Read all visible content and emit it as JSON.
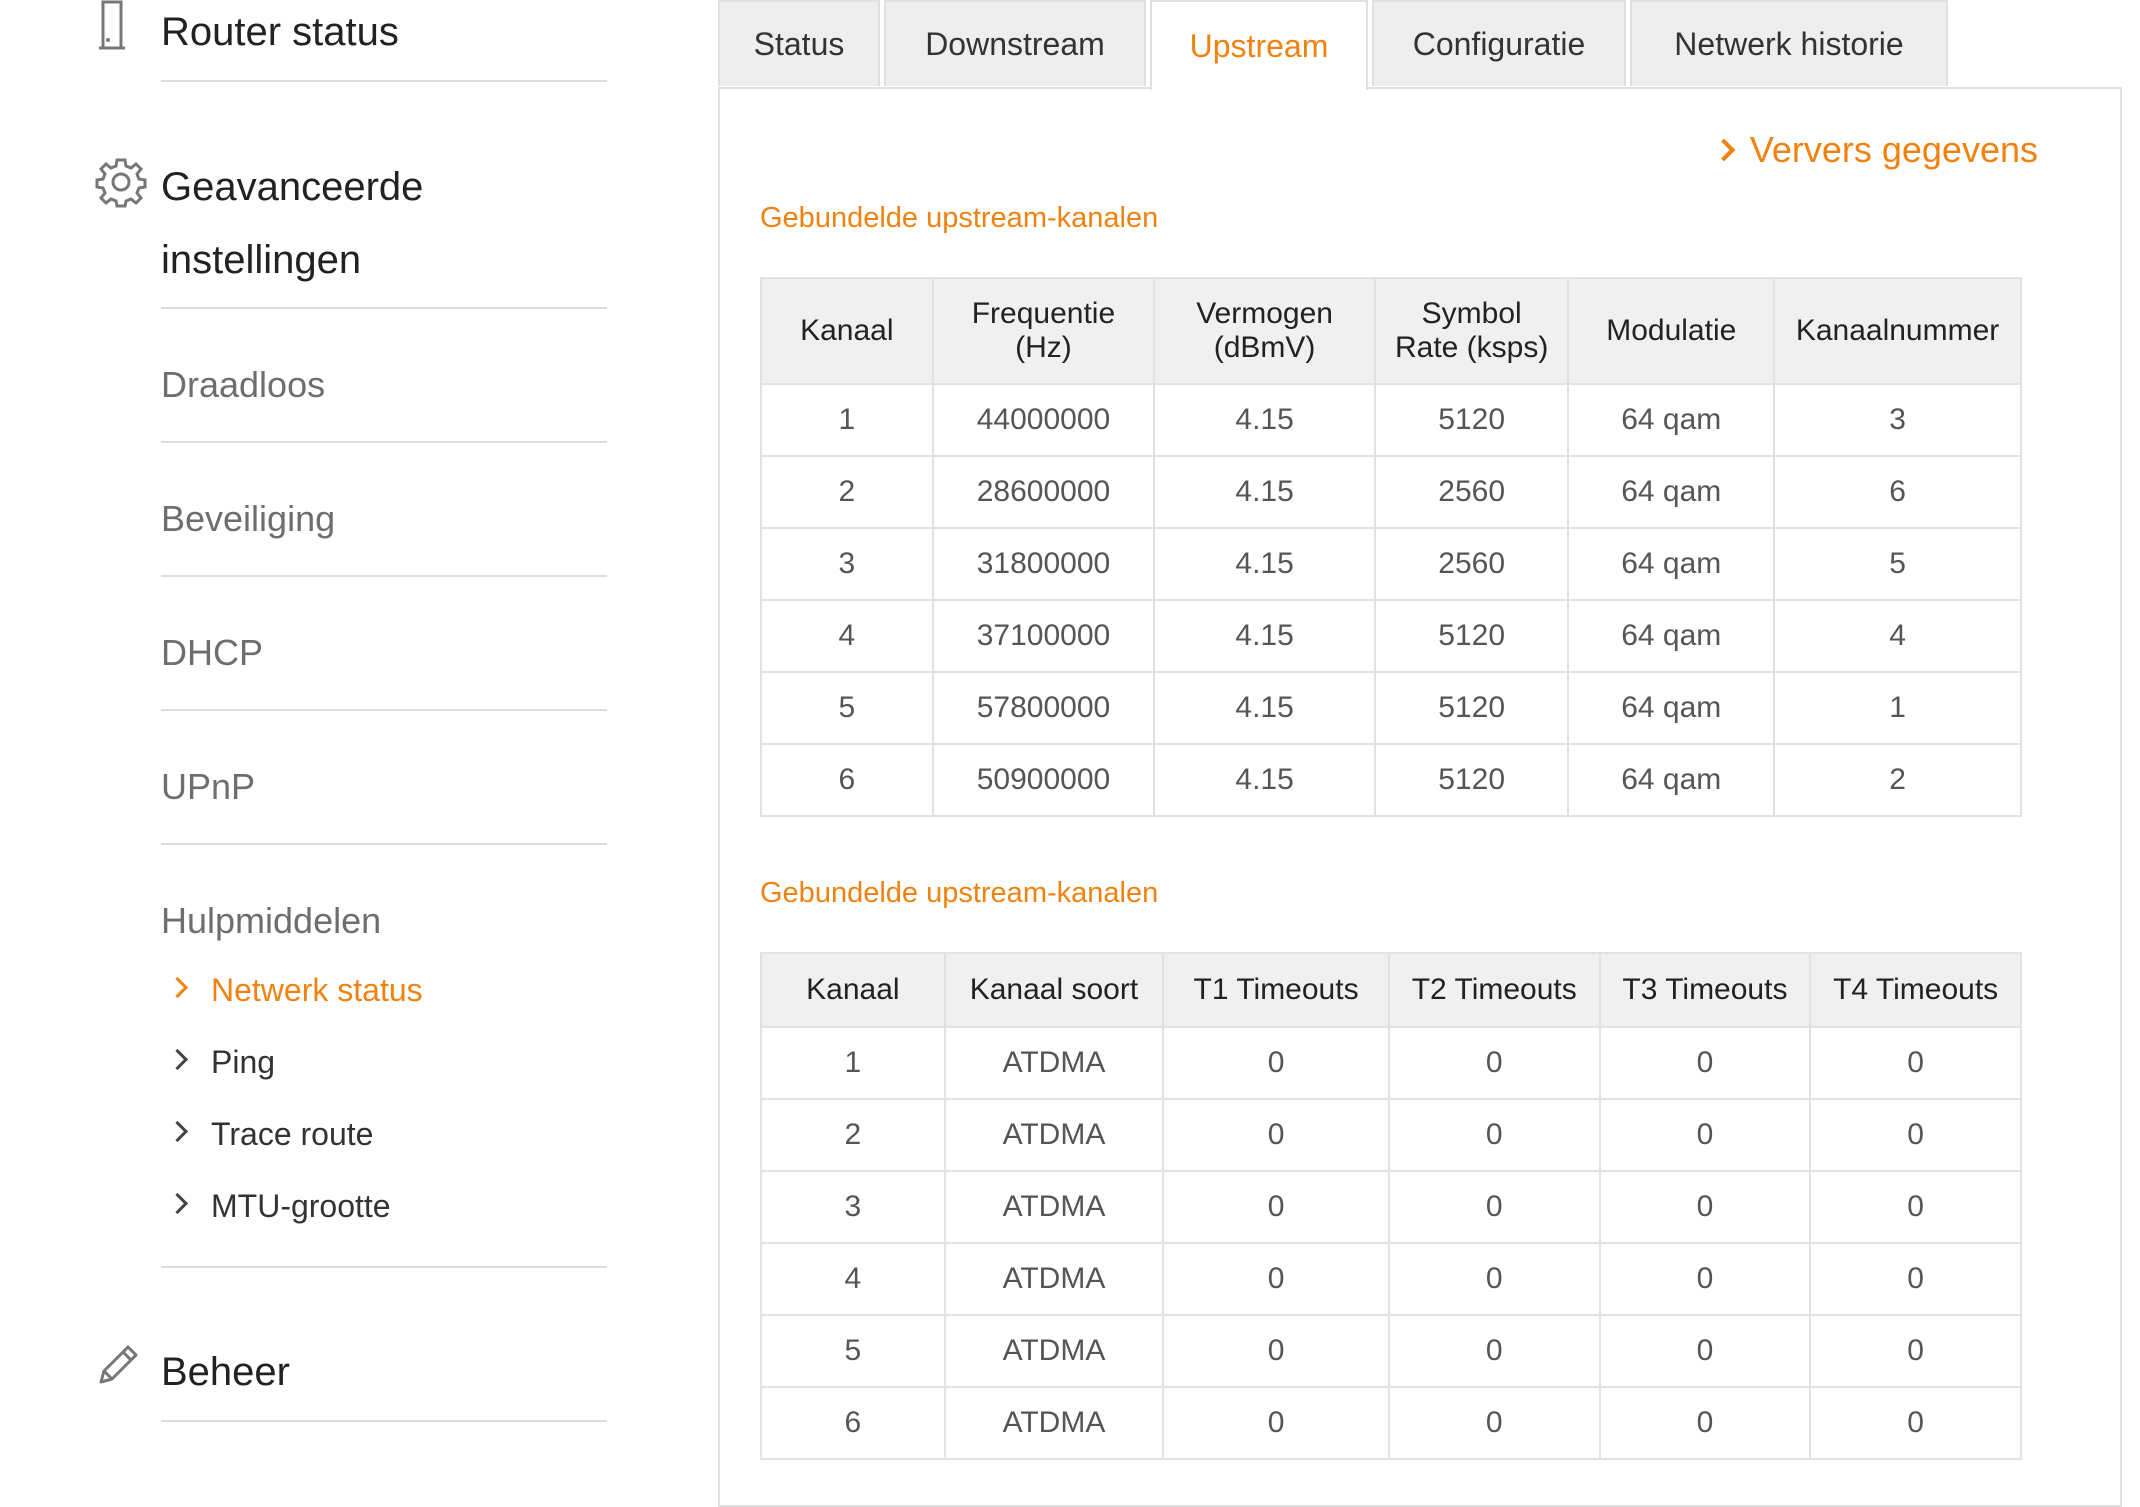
{
  "sidebar": {
    "router_status": "Router status",
    "advanced_line1": "Geavanceerde",
    "advanced_line2": "instellingen",
    "items": [
      "Draadloos",
      "Beveiliging",
      "DHCP",
      "UPnP"
    ],
    "tools": {
      "label": "Hulpmiddelen",
      "subitems": [
        "Netwerk status",
        "Ping",
        "Trace route",
        "MTU-grootte"
      ],
      "active": "Netwerk status"
    },
    "beheer": "Beheer"
  },
  "tabs": [
    "Status",
    "Downstream",
    "Upstream",
    "Configuratie",
    "Netwerk historie"
  ],
  "active_tab": "Upstream",
  "refresh_label": "Ververs gegevens",
  "colors": {
    "accent": "#f0820f",
    "header_bg": "#f0f0f0",
    "border": "#e2e2e2"
  },
  "table1": {
    "title": "Gebundelde upstream-kanalen",
    "headers": [
      [
        "Kanaal"
      ],
      [
        "Frequentie",
        "(Hz)"
      ],
      [
        "Vermogen",
        "(dBmV)"
      ],
      [
        "Symbol",
        "Rate (ksps)"
      ],
      [
        "Modulatie"
      ],
      [
        "Kanaalnummer"
      ]
    ],
    "rows": [
      [
        "1",
        "44000000",
        "4.15",
        "5120",
        "64 qam",
        "3"
      ],
      [
        "2",
        "28600000",
        "4.15",
        "2560",
        "64 qam",
        "6"
      ],
      [
        "3",
        "31800000",
        "4.15",
        "2560",
        "64 qam",
        "5"
      ],
      [
        "4",
        "37100000",
        "4.15",
        "5120",
        "64 qam",
        "4"
      ],
      [
        "5",
        "57800000",
        "4.15",
        "5120",
        "64 qam",
        "1"
      ],
      [
        "6",
        "50900000",
        "4.15",
        "5120",
        "64 qam",
        "2"
      ]
    ]
  },
  "table2": {
    "title": "Gebundelde upstream-kanalen",
    "headers": [
      "Kanaal",
      "Kanaal soort",
      "T1 Timeouts",
      "T2 Timeouts",
      "T3 Timeouts",
      "T4 Timeouts"
    ],
    "rows": [
      [
        "1",
        "ATDMA",
        "0",
        "0",
        "0",
        "0"
      ],
      [
        "2",
        "ATDMA",
        "0",
        "0",
        "0",
        "0"
      ],
      [
        "3",
        "ATDMA",
        "0",
        "0",
        "0",
        "0"
      ],
      [
        "4",
        "ATDMA",
        "0",
        "0",
        "0",
        "0"
      ],
      [
        "5",
        "ATDMA",
        "0",
        "0",
        "0",
        "0"
      ],
      [
        "6",
        "ATDMA",
        "0",
        "0",
        "0",
        "0"
      ]
    ]
  }
}
